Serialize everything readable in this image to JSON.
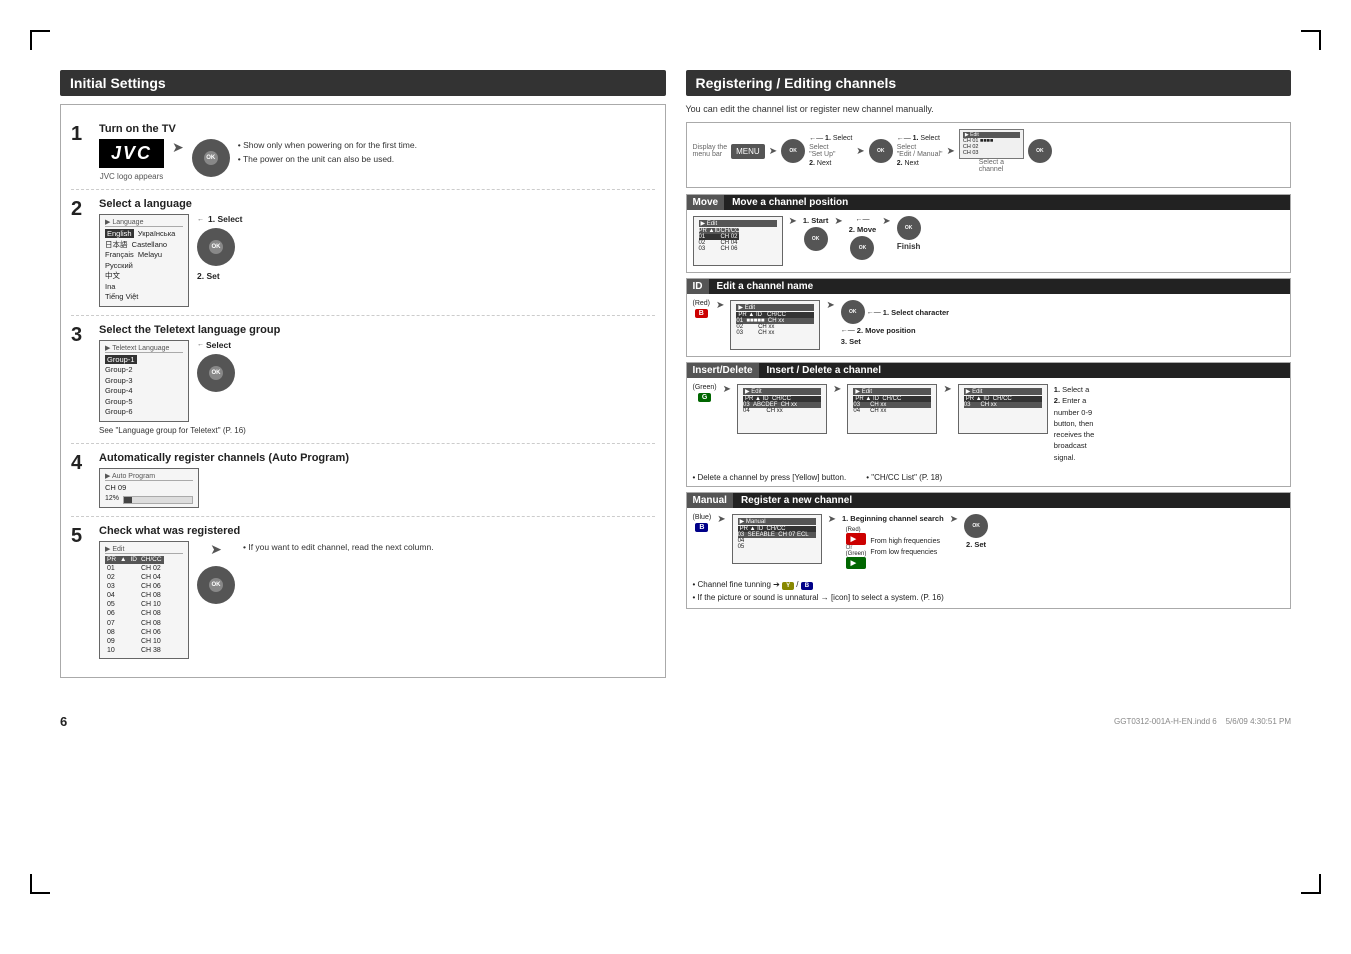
{
  "page": {
    "title": "Initial Settings & Registering/Editing channels",
    "page_number": "6",
    "filename": "GGT0312-001A-H-EN.indd  6",
    "timestamp": "5/6/09  4:30:51 PM"
  },
  "left_section": {
    "title": "Initial Settings",
    "steps": [
      {
        "num": "1",
        "title": "Turn on the TV",
        "subtitle": "JVC logo appears",
        "notes": [
          "Show only when powering on for the first time.",
          "The power on the unit can also be used."
        ]
      },
      {
        "num": "2",
        "title": "Select a language",
        "languages": [
          "English",
          "Українська",
          "日本語",
          "Castellano",
          "Français",
          "Melayu",
          "Русский",
          "中文",
          "Ina",
          "Tiếng Việt"
        ],
        "action1": "1. Select",
        "action2": "2. Set"
      },
      {
        "num": "3",
        "title": "Select the Teletext language group",
        "groups": [
          "Group-1",
          "Group-2",
          "Group-3",
          "Group-4",
          "Group-5",
          "Group-6"
        ],
        "action": "Select",
        "note": "See \"Language group for Teletext\" (P. 16)"
      },
      {
        "num": "4",
        "title": "Automatically register channels (Auto Program)",
        "progress_label": "CH 09",
        "progress_pct": "12%"
      },
      {
        "num": "5",
        "title": "Check what was registered",
        "channels": [
          {
            "pr": "01",
            "id": "",
            "chcc": "CH 02"
          },
          {
            "pr": "02",
            "id": "",
            "chcc": "CH 04"
          },
          {
            "pr": "03",
            "id": "",
            "chcc": "CH 06"
          },
          {
            "pr": "04",
            "id": "",
            "chcc": "CH 08"
          },
          {
            "pr": "05",
            "id": "",
            "chcc": "CH 10"
          },
          {
            "pr": "06",
            "id": "",
            "chcc": "CH 08"
          },
          {
            "pr": "07",
            "id": "",
            "chcc": "CH 08"
          },
          {
            "pr": "08",
            "id": "",
            "chcc": "CH 06"
          },
          {
            "pr": "09",
            "id": "",
            "chcc": "CH 10"
          },
          {
            "pr": "10",
            "id": "",
            "chcc": "CH 38"
          }
        ],
        "note": "If you want to edit channel, read the next column."
      }
    ]
  },
  "right_section": {
    "title": "Registering / Editing channels",
    "intro": "You can edit the channel list or register new channel manually.",
    "flow_labels": [
      "Display the menu bar",
      "Select \"Set Up\"",
      "Select \"Edit / Manual\""
    ],
    "flow_actions": [
      "1. Select",
      "2. Next",
      "1. Select",
      "2. Next",
      "Select a channel"
    ],
    "sub_sections": [
      {
        "tag": "Move",
        "title": "Move a channel position",
        "step1": "1. Start",
        "step2": "2. Move",
        "finish": "Finish"
      },
      {
        "tag": "ID",
        "title": "Edit a channel name",
        "color_btn": "Red",
        "color_label": "(Red)",
        "step1": "1. Select character",
        "step2": "2. Move position",
        "step3": "3. Set"
      },
      {
        "tag": "Insert/Delete",
        "title": "Insert / Delete a channel",
        "color_btn": "Green",
        "color_label": "(Green)",
        "step1": "1. Select a",
        "step2": "2. Enter a number 0-9 button, then receives the broadcast signal.",
        "ch_cc_label": "CH/CC",
        "note1": "Delete a channel by press [Yellow] button.",
        "note2": "\"CH/CC List\" (P. 18)"
      },
      {
        "tag": "Manual",
        "title": "Register a new channel",
        "color_btn": "Blue",
        "color_label": "(Blue)",
        "step1": "1. Beginning channel search",
        "step2": "2. Set",
        "freq_high": "From high frequencies",
        "freq_low": "From low frequencies",
        "color_red": "Red",
        "color_green": "Green",
        "note1": "Channel fine tunning → [Yellow] / [Blue]",
        "note2": "If the picture or sound is unnatural → [icon] to select a system. (P. 16)"
      }
    ]
  }
}
